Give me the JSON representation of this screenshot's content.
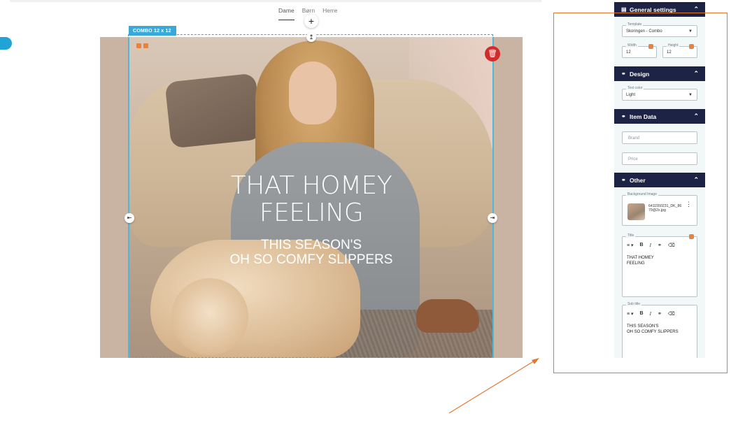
{
  "nav": {
    "tabs": [
      "Dame",
      "Børn",
      "Herre"
    ],
    "active_index": 0
  },
  "block": {
    "badge": "COMBO  12 x 12",
    "title": "THAT HOMEY\nFEELING",
    "subtitle": "THIS SEASON'S\nOH SO COMFY SLIPPERS"
  },
  "panel": {
    "general": {
      "header": "General settings",
      "template_label": "Template",
      "template_value": "Skoringen - Combo",
      "width_label": "Width",
      "width_value": "12",
      "height_label": "Height",
      "height_value": "12"
    },
    "design": {
      "header": "Design",
      "text_color_label": "Text color",
      "text_color_value": "Light"
    },
    "item_data": {
      "header": "Item Data",
      "brand_placeholder": "Brand",
      "price_placeholder": "Price"
    },
    "other": {
      "header": "Other",
      "bg_image_label": "Background Image",
      "bg_image_file": "6411550231_DK_8679@2x.jpg",
      "title_label": "Title",
      "title_text": "THAT HOMEY\nFEELING",
      "subtitle_label": "Sub title",
      "subtitle_text": "THIS SEASON'S\nOH SO COMFY SLIPPERS"
    },
    "toolbar": {
      "align": "≡ ▾",
      "bold": "B",
      "italic": "I",
      "link": "⚭",
      "clear": "⌫"
    }
  },
  "icons": {
    "add": "plus-icon",
    "drag": "drag-handle-icon",
    "resize": "resize-icon",
    "delete": "trash-icon",
    "settings": "sliders-icon",
    "link": "link-icon",
    "chevron": "chevron-up-icon"
  },
  "colors": {
    "accent": "#3aa8d8",
    "panel_header": "#1d2345",
    "highlight": "#e5772f",
    "delete": "#d12c2c"
  }
}
